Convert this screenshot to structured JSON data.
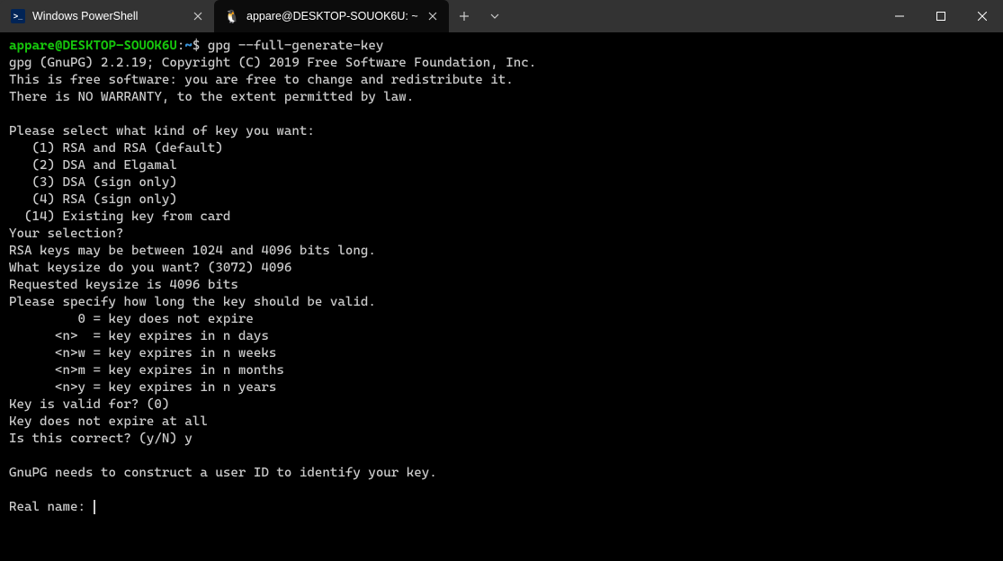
{
  "tabs": [
    {
      "label": "Windows PowerShell",
      "active": false
    },
    {
      "label": "appare@DESKTOP-SOUOK6U: ~",
      "active": true
    }
  ],
  "prompt": {
    "user": "appare@DESKTOP-SOUOK6U",
    "sep": ":",
    "path": "~",
    "dollar": "$",
    "command": "gpg --full-generate-key"
  },
  "output": {
    "l1": "gpg (GnuPG) 2.2.19; Copyright (C) 2019 Free Software Foundation, Inc.",
    "l2": "This is free software: you are free to change and redistribute it.",
    "l3": "There is NO WARRANTY, to the extent permitted by law.",
    "l4": "",
    "l5": "Please select what kind of key you want:",
    "l6": "   (1) RSA and RSA (default)",
    "l7": "   (2) DSA and Elgamal",
    "l8": "   (3) DSA (sign only)",
    "l9": "   (4) RSA (sign only)",
    "l10": "  (14) Existing key from card",
    "l11": "Your selection?",
    "l12": "RSA keys may be between 1024 and 4096 bits long.",
    "l13": "What keysize do you want? (3072) 4096",
    "l14": "Requested keysize is 4096 bits",
    "l15": "Please specify how long the key should be valid.",
    "l16": "         0 = key does not expire",
    "l17": "      <n>  = key expires in n days",
    "l18": "      <n>w = key expires in n weeks",
    "l19": "      <n>m = key expires in n months",
    "l20": "      <n>y = key expires in n years",
    "l21": "Key is valid for? (0)",
    "l22": "Key does not expire at all",
    "l23": "Is this correct? (y/N) y",
    "l24": "",
    "l25": "GnuPG needs to construct a user ID to identify your key.",
    "l26": "",
    "l27": "Real name: "
  }
}
